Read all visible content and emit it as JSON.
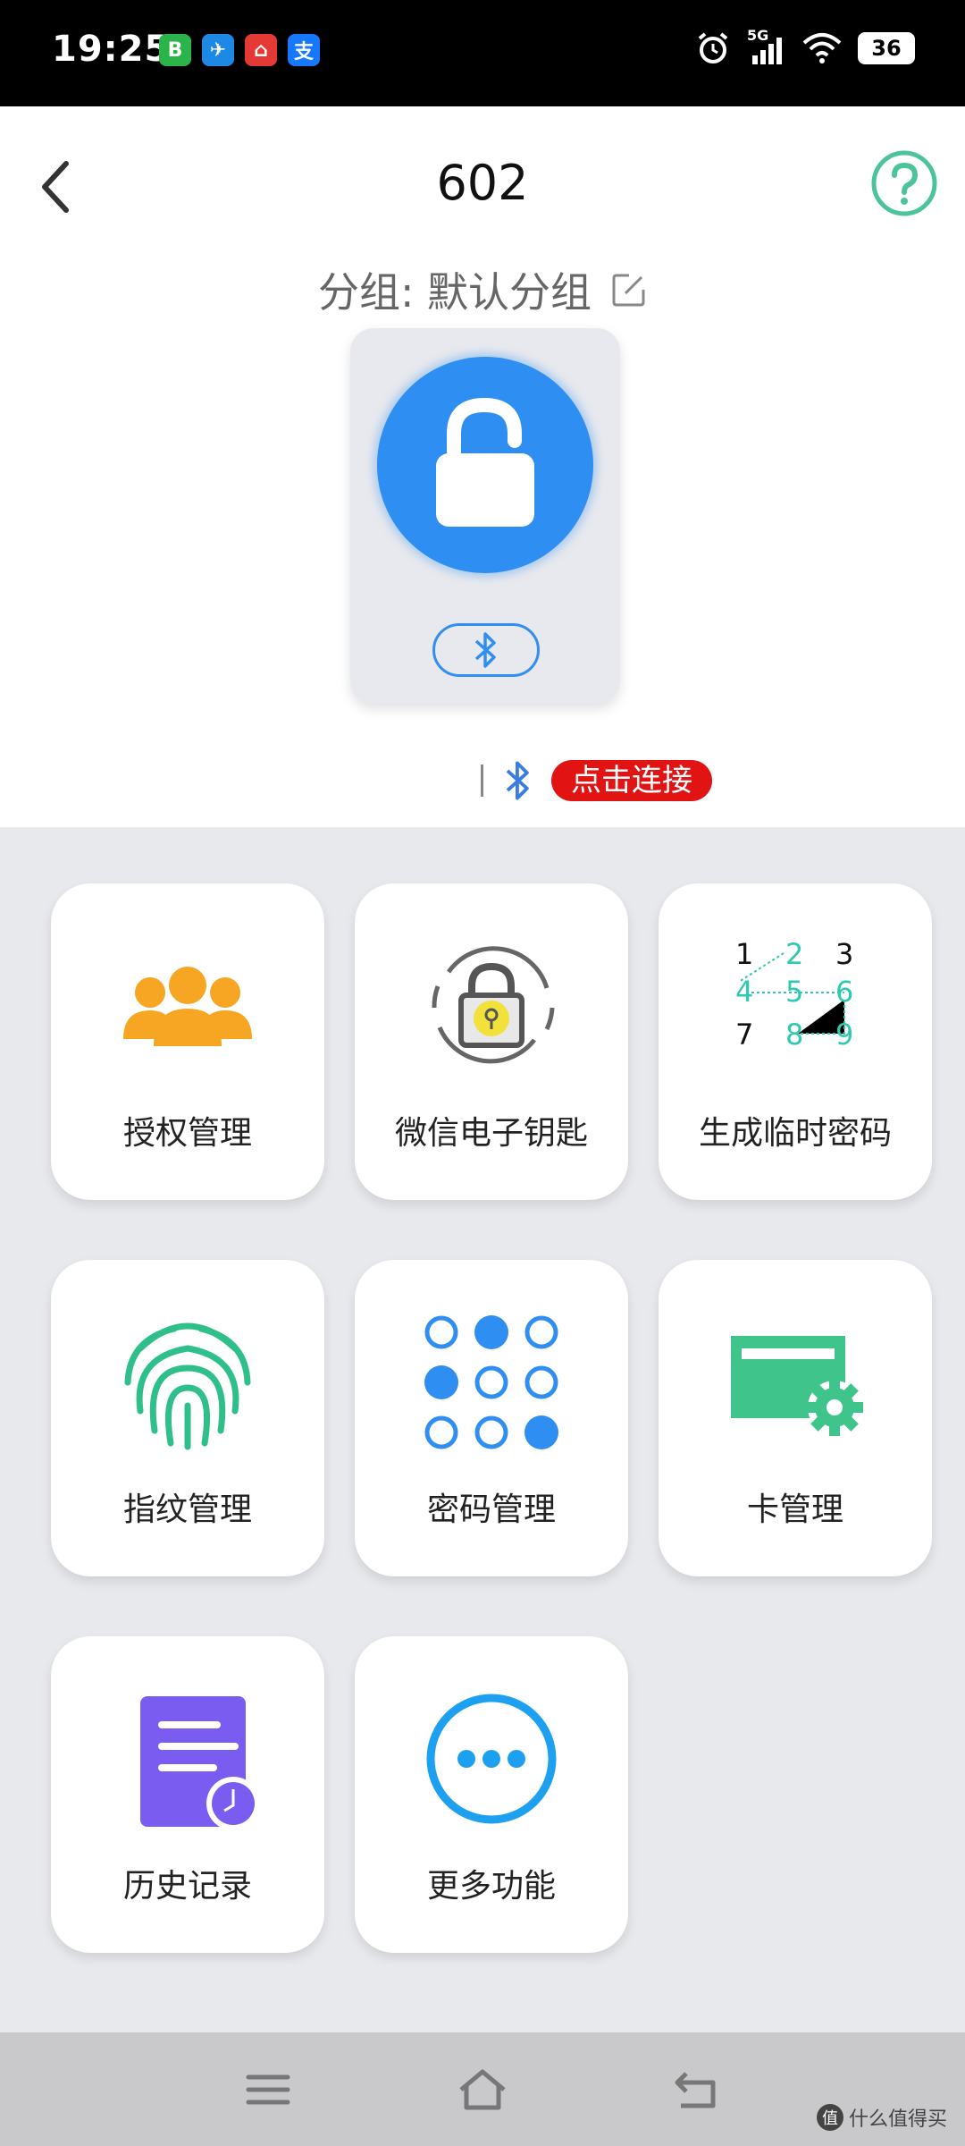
{
  "status_bar": {
    "time": "19:25",
    "app_icons": [
      {
        "name": "app-icon-1",
        "glyph": "B",
        "color": "#2bb44a"
      },
      {
        "name": "app-icon-2",
        "glyph": "✈",
        "color": "#1e88e5"
      },
      {
        "name": "app-icon-3",
        "glyph": "⌂",
        "color": "#e53935"
      },
      {
        "name": "app-icon-4",
        "glyph": "支",
        "color": "#1677ff"
      }
    ],
    "network": "5G",
    "battery": "36"
  },
  "header": {
    "title": "602",
    "group_label": "分组: 默认分组"
  },
  "connection": {
    "connect_label": "点击连接"
  },
  "menu": [
    {
      "label": "授权管理",
      "icon": "users-icon"
    },
    {
      "label": "微信电子钥匙",
      "icon": "wechat-key-icon"
    },
    {
      "label": "生成临时密码",
      "icon": "temp-password-icon"
    },
    {
      "label": "指纹管理",
      "icon": "fingerprint-icon"
    },
    {
      "label": "密码管理",
      "icon": "password-keypad-icon"
    },
    {
      "label": "卡管理",
      "icon": "card-icon"
    },
    {
      "label": "历史记录",
      "icon": "history-icon"
    },
    {
      "label": "更多功能",
      "icon": "more-icon"
    }
  ],
  "temp_password_digits": [
    "1",
    "2",
    "3",
    "4",
    "5",
    "6",
    "7",
    "8",
    "9"
  ],
  "watermark": {
    "logo": "值",
    "text": "什么值得买"
  },
  "colors": {
    "accent_blue": "#2f8ef2",
    "green": "#2fbf8a",
    "orange": "#f6a623",
    "purple": "#7b5cf0",
    "red": "#e21313"
  }
}
